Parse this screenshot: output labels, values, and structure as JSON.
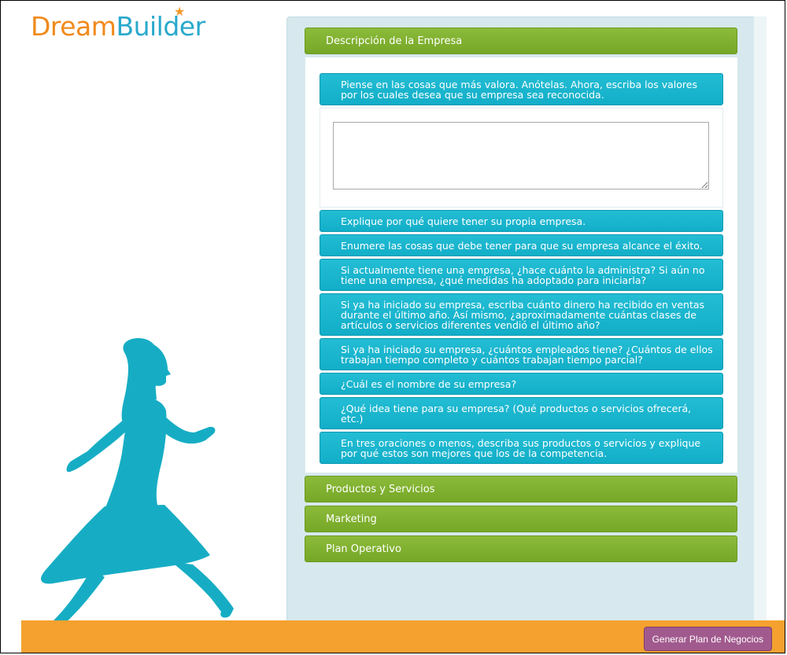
{
  "logo": {
    "part1": "Dream",
    "part2": "Builder",
    "star": "★"
  },
  "sections": {
    "open": {
      "title": "Descripción de la Empresa",
      "questions": [
        "Piense en las cosas que más valora. Anótelas. Ahora, escriba los valores por los cuales desea que su empresa sea reconocida.",
        "Explique por qué quiere tener su propia empresa.",
        "Enumere las cosas que debe tener para que su empresa alcance el éxito.",
        "Si actualmente tiene una empresa, ¿hace cuánto la administra? Si aún no tiene una empresa, ¿qué medidas ha adoptado para iniciarla?",
        "Si ya ha iniciado su empresa, escriba cuánto dinero ha recibido en ventas durante el último año. Así mismo, ¿aproximadamente cuántas clases de artículos o servicios diferentes vendió el último año?",
        "Si ya ha iniciado su empresa, ¿cuántos empleados tiene? ¿Cuántos de ellos trabajan tiempo completo y cuántos trabajan tiempo parcial?",
        "¿Cuál es el nombre de su empresa?",
        "¿Qué idea tiene para su empresa? (Qué productos o servicios ofrecerá, etc.)",
        "En tres oraciones o menos, describa sus productos o servicios y explique por qué estos son mejores que los de la competencia."
      ],
      "answer_value": ""
    },
    "collapsed": [
      "Productos y Servicios",
      "Marketing",
      "Plan Operativo"
    ]
  },
  "footer": {
    "generate_label": "Generar Plan de Negocios"
  },
  "colors": {
    "header_green": "#80b030",
    "question_teal": "#1ab6cd",
    "footer_orange": "#f4a12f",
    "button_purple": "#a15a8e",
    "silhouette": "#16adc4"
  },
  "icons": {
    "silhouette": "walking-woman-silhouette",
    "logo_star": "star-icon"
  }
}
